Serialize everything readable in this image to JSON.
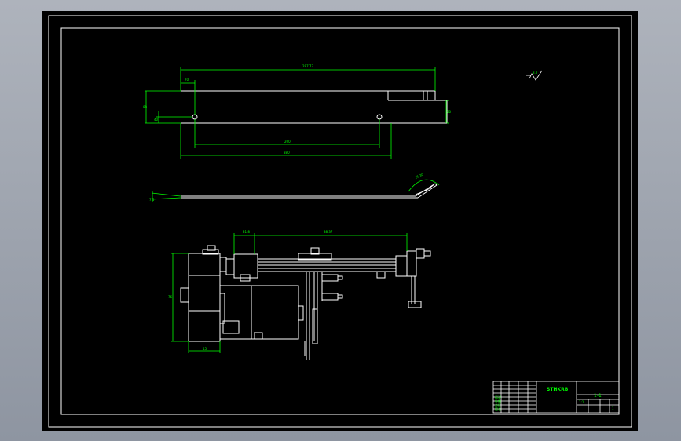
{
  "drawing": {
    "dims": {
      "top_overall": "287.77",
      "top_left_small": "70",
      "top_left_height": "80",
      "top_hole_offset": "40",
      "top_inner_span": "200",
      "top_outer_span": "380",
      "top_right_height": "20",
      "side_left_height": "7.5",
      "side_arc": "15.30",
      "asm_left_span": "31.8",
      "asm_right_span": "38.37",
      "asm_height": "76",
      "asm_width": "45"
    },
    "roughness": "3.2",
    "title_block": {
      "drawing_name": "STHKRB",
      "drawing_number": "1-1",
      "scale_label": "1:1",
      "sheet_no": "1",
      "row_labels": [
        "标记",
        "处数",
        "分区",
        "签名"
      ]
    }
  },
  "colors": {
    "background": "#000000",
    "line": "#ffffff",
    "dimension": "#00ff00",
    "frame_outer": "#ffffff"
  }
}
